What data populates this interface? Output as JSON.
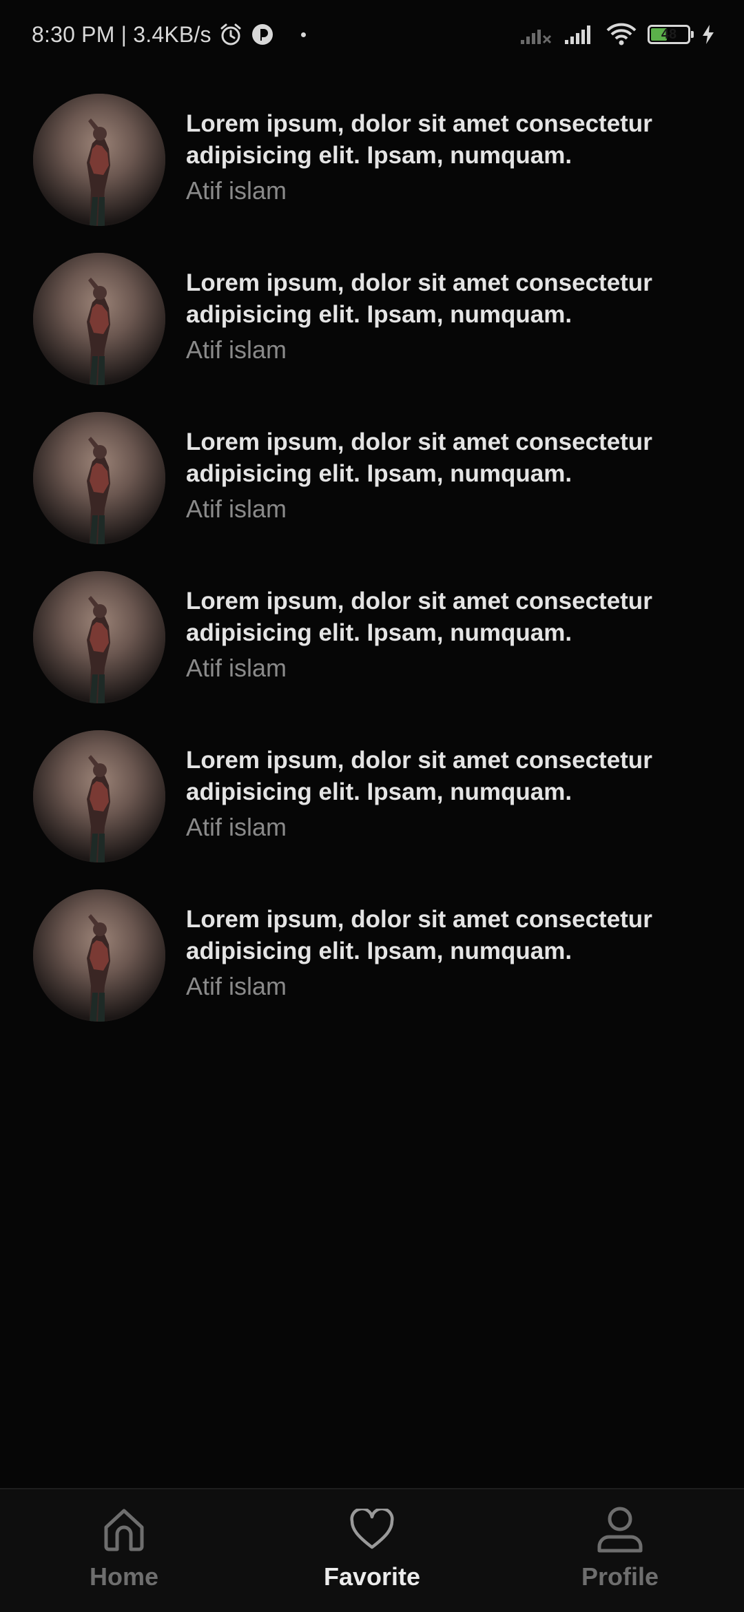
{
  "status_bar": {
    "time_speed": "8:30 PM | 3.4KB/s",
    "battery_level": "48",
    "icons": [
      "alarm-icon",
      "app-notification-icon",
      "dot-icon",
      "signal-off-icon",
      "signal-icon",
      "wifi-icon",
      "battery-icon",
      "charging-icon"
    ]
  },
  "songs": [
    {
      "title": "Lorem ipsum, dolor sit amet consectetur adipisicing elit. Ipsam, numquam.",
      "artist": "Atif islam"
    },
    {
      "title": "Lorem ipsum, dolor sit amet consectetur adipisicing elit. Ipsam, numquam.",
      "artist": "Atif islam"
    },
    {
      "title": "Lorem ipsum, dolor sit amet consectetur adipisicing elit. Ipsam, numquam.",
      "artist": "Atif islam"
    },
    {
      "title": "Lorem ipsum, dolor sit amet consectetur adipisicing elit. Ipsam, numquam.",
      "artist": "Atif islam"
    },
    {
      "title": "Lorem ipsum, dolor sit amet consectetur adipisicing elit. Ipsam, numquam.",
      "artist": "Atif islam"
    },
    {
      "title": "Lorem ipsum, dolor sit amet consectetur adipisicing elit. Ipsam, numquam.",
      "artist": "Atif islam"
    }
  ],
  "bottom_nav": {
    "items": [
      {
        "label": "Home",
        "icon": "home-icon",
        "active": false
      },
      {
        "label": "Favorite",
        "icon": "heart-icon",
        "active": true
      },
      {
        "label": "Profile",
        "icon": "user-icon",
        "active": false
      }
    ]
  },
  "colors": {
    "background": "#060606",
    "active_label": "#ececec",
    "inactive_label": "#6e6e6e",
    "artist_text": "#8a8a8a",
    "battery_fill": "#5bb04a"
  }
}
